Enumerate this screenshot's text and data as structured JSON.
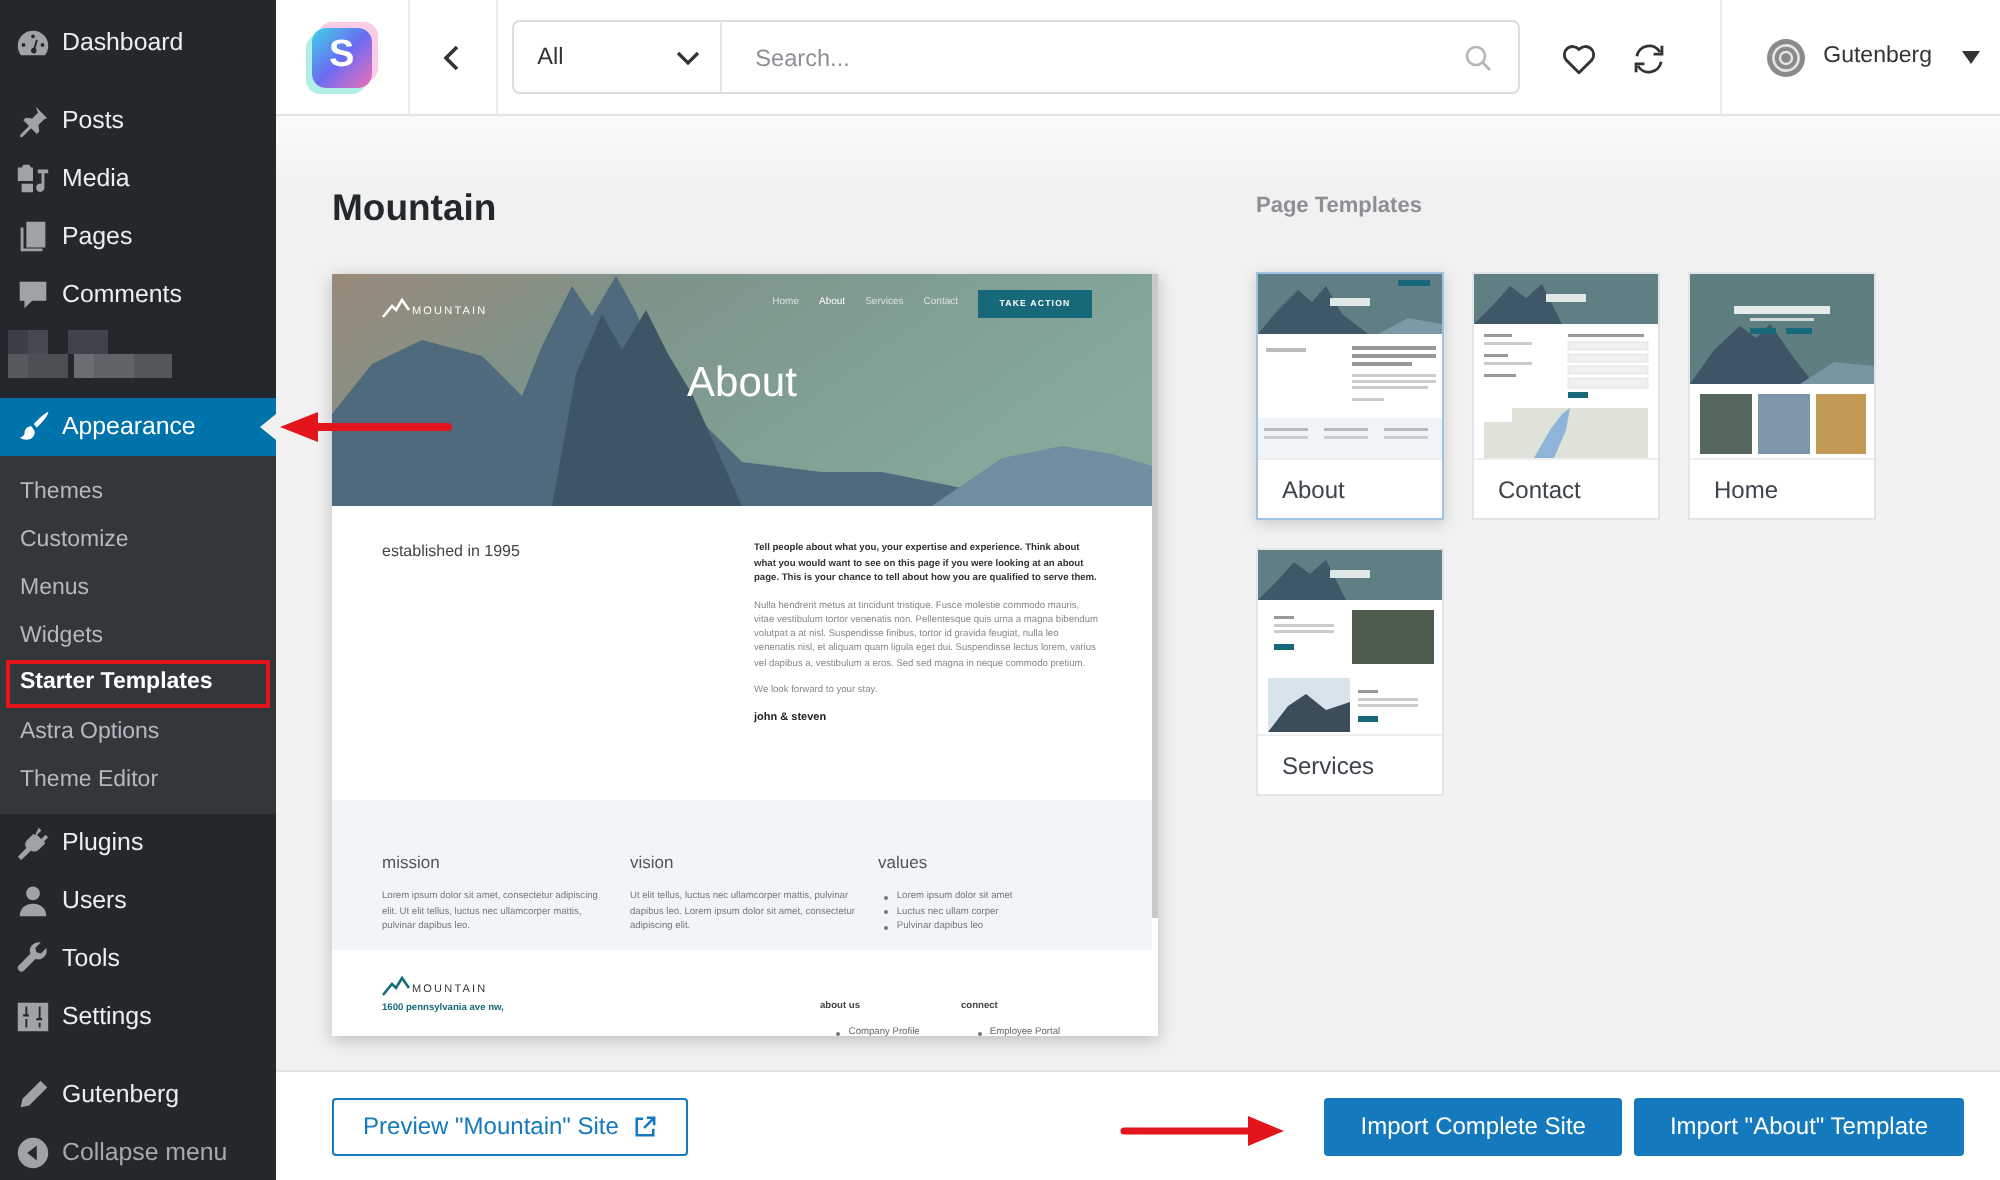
{
  "sidebar": {
    "sections": [
      {
        "items": [
          {
            "kind": "link",
            "label": "Dashboard",
            "selected": false,
            "pointer_arrow": false
          }
        ]
      },
      {
        "items": [
          {
            "kind": "link",
            "label": "Posts",
            "selected": false,
            "pointer_arrow": false
          },
          {
            "kind": "link",
            "label": "Media",
            "selected": false,
            "pointer_arrow": false
          },
          {
            "kind": "link",
            "label": "Pages",
            "selected": false,
            "pointer_arrow": false
          },
          {
            "kind": "link",
            "label": "Comments",
            "selected": false,
            "pointer_arrow": false
          },
          {
            "kind": "redacted"
          }
        ]
      },
      {
        "items": [
          {
            "kind": "link",
            "label": "Appearance",
            "selected": true,
            "pointer_arrow": true,
            "children": [
              {
                "label": "Themes",
                "selected": false,
                "boxed": false
              },
              {
                "label": "Customize",
                "selected": false,
                "boxed": false
              },
              {
                "label": "Menus",
                "selected": false,
                "boxed": false
              },
              {
                "label": "Widgets",
                "selected": false,
                "boxed": false
              },
              {
                "label": "Starter Templates",
                "selected": true,
                "boxed": true
              },
              {
                "label": "Astra Options",
                "selected": false,
                "boxed": false
              },
              {
                "label": "Theme Editor",
                "selected": false,
                "boxed": false
              }
            ]
          },
          {
            "kind": "link",
            "label": "Plugins",
            "selected": false,
            "pointer_arrow": false
          },
          {
            "kind": "link",
            "label": "Users",
            "selected": false,
            "pointer_arrow": false
          },
          {
            "kind": "link",
            "label": "Tools",
            "selected": false,
            "pointer_arrow": false
          },
          {
            "kind": "link",
            "label": "Settings",
            "selected": false,
            "pointer_arrow": false
          }
        ]
      },
      {
        "items": [
          {
            "kind": "link",
            "label": "Gutenberg",
            "selected": false,
            "pointer_arrow": false
          }
        ]
      }
    ],
    "collapse_button": {
      "label": "Collapse menu"
    }
  },
  "topbar": {
    "logo_text": "S",
    "filter": {
      "value": "All"
    },
    "search": {
      "placeholder": "Search..."
    },
    "page_builder": {
      "label": "Gutenberg"
    }
  },
  "main": {
    "title": "Mountain",
    "preview": {
      "logo": "MOUNTAIN",
      "nav": [
        {
          "label": "Home",
          "selected": false
        },
        {
          "label": "About",
          "selected": true
        },
        {
          "label": "Services",
          "selected": false
        },
        {
          "label": "Contact",
          "selected": false
        }
      ],
      "cta": "TAKE ACTION",
      "hero_title": "About",
      "tagline": "established in 1995",
      "intro": "Tell people about what you, your expertise and experience. Think about what you would want to see on this page if you were looking at an about page. This is your chance to tell about how you are qualified to serve them.",
      "body": "Nulla hendrerit metus at tincidunt tristique. Fusce molestie commodo mauris, vitae vestibulum tortor venenatis non. Pellentesque quis urna a magna bibendum volutpat a at nisl. Suspendisse finibus, tortor id gravida feugiat, nulla leo venenatis nisl, et aliquam quam ligula eget dui. Suspendisse lectus lorem, varius vel dapibus a, vestibulum a eros. Sed sed magna in neque commodo pretium.",
      "closing": "We look forward to your stay.",
      "signature": "john & steven",
      "features": [
        {
          "kind": "text",
          "heading": "mission",
          "text": "Lorem ipsum dolor sit amet, consectetur adipiscing elit. Ut elit tellus, luctus nec ullamcorper mattis, pulvinar dapibus leo."
        },
        {
          "kind": "text",
          "heading": "vision",
          "text": "Ut elit tellus, luctus nec ullamcorper mattis, pulvinar dapibus leo. Lorem ipsum dolor sit amet, consectetur adipiscing elit."
        },
        {
          "kind": "list",
          "heading": "values",
          "items": [
            "Lorem ipsum dolor sit amet",
            "Luctus nec ullam corper",
            "Pulvinar dapibus leo"
          ]
        }
      ],
      "footer": {
        "logo": "MOUNTAIN",
        "address": "1600 pennsylvania ave nw,",
        "columns": [
          {
            "heading": "about us",
            "items": [
              "Company Profile"
            ]
          },
          {
            "heading": "connect",
            "items": [
              "Employee Portal"
            ]
          }
        ]
      }
    },
    "templates_heading": "Page Templates",
    "templates": [
      {
        "label": "About",
        "selected": true
      },
      {
        "label": "Contact",
        "selected": false
      },
      {
        "label": "Home",
        "selected": false
      },
      {
        "label": "Services",
        "selected": false
      }
    ]
  },
  "bottom_bar": {
    "buttons": [
      {
        "kind": "outline",
        "label": "Preview \"Mountain\" Site",
        "pointer_arrow": false
      },
      {
        "kind": "primary",
        "label": "Import Complete Site",
        "pointer_arrow": true
      },
      {
        "kind": "primary",
        "label": "Import \"About\" Template",
        "pointer_arrow": false
      }
    ]
  }
}
